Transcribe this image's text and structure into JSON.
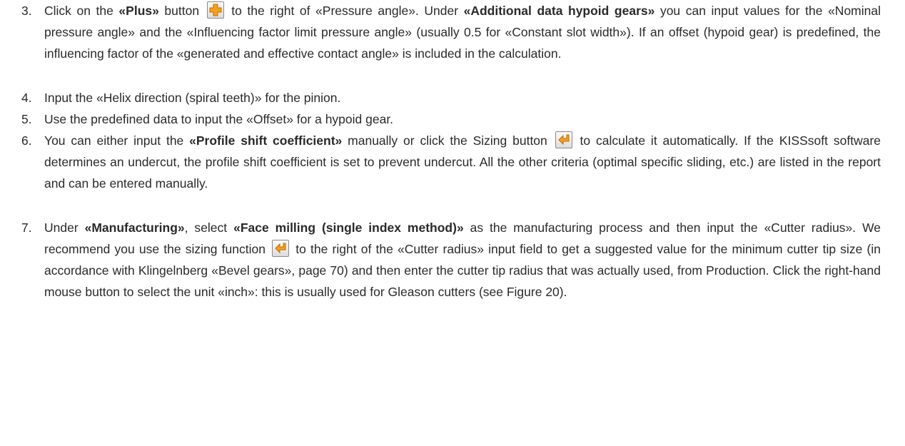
{
  "steps": [
    {
      "number": "3.",
      "segments": [
        {
          "t": "Click on the "
        },
        {
          "t": "«Plus»",
          "b": true
        },
        {
          "t": " button "
        },
        {
          "icon": "plus-icon"
        },
        {
          "t": " to the right of «Pressure angle». Under "
        },
        {
          "t": "«Additional data hypoid gears»",
          "b": true
        },
        {
          "t": " you can input values for the «Nominal pressure angle» and the «Influencing factor limit pressure angle» (usually 0.5 for «Constant slot width»). If an offset (hypoid gear) is predefined, the influencing factor of the «generated and effective contact angle» is included in the calculation."
        }
      ]
    },
    {
      "number": "4.",
      "segments": [
        {
          "t": "Input the «Helix direction (spiral teeth)» for the pinion."
        }
      ]
    },
    {
      "number": "5.",
      "segments": [
        {
          "t": "Use the predefined data to input the «Offset» for a hypoid gear."
        }
      ]
    },
    {
      "number": "6.",
      "segments": [
        {
          "t": "You can either input the "
        },
        {
          "t": "«Profile shift coefficient»",
          "b": true
        },
        {
          "t": " manually or click the Sizing button "
        },
        {
          "icon": "sizing-arrow-icon"
        },
        {
          "t": " to calculate it automatically. If the KISSsoft software determines an undercut, the profile shift coefficient is set to prevent undercut. All the other criteria (optimal specific sliding, etc.) are listed in the report and can be entered manually."
        }
      ]
    },
    {
      "number": "7.",
      "segments": [
        {
          "t": "Under "
        },
        {
          "t": "«Manufacturing»",
          "b": true
        },
        {
          "t": ", select "
        },
        {
          "t": "«Face milling (single index method)»",
          "b": true
        },
        {
          "t": " as the manufacturing process and then input the «Cutter radius». We recommend you use the sizing function "
        },
        {
          "icon": "sizing-arrow-icon"
        },
        {
          "t": " to the right of the «Cutter radius» input field to get a suggested value for the minimum cutter tip size (in accordance with Klingelnberg «Bevel gears», page 70) and then enter the cutter tip radius that was actually used, from Production. Click the right-hand mouse button to select the unit «inch»: this is usually used for Gleason cutters (see Figure 20)."
        }
      ]
    }
  ],
  "colors": {
    "text": "#2a2a2a",
    "icon_orange": "#f6a019",
    "icon_border": "#8a8a8a"
  }
}
